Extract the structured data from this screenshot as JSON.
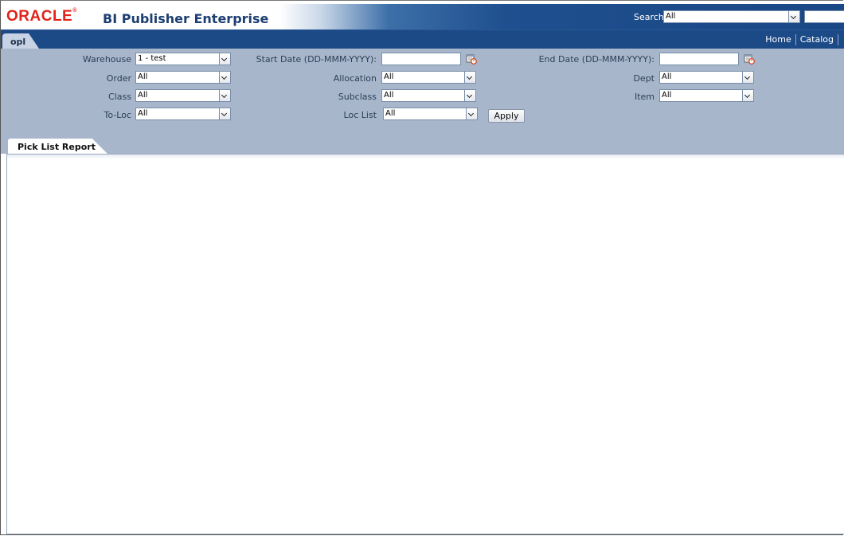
{
  "header": {
    "logo_text": "ORACLE",
    "app_title": "BI Publisher Enterprise",
    "search_label": "Search",
    "search_scope": "All",
    "search_input": ""
  },
  "nav": {
    "tab_label": "opl",
    "links": [
      "Home",
      "Catalog"
    ]
  },
  "params": {
    "warehouse": {
      "label": "Warehouse",
      "value": "1 - test"
    },
    "order": {
      "label": "Order",
      "value": "All"
    },
    "class": {
      "label": "Class",
      "value": "All"
    },
    "to_loc": {
      "label": "To-Loc",
      "value": "All"
    },
    "start_date": {
      "label": "Start Date (DD-MMM-YYYY):",
      "value": ""
    },
    "allocation": {
      "label": "Allocation",
      "value": "All"
    },
    "subclass": {
      "label": "Subclass",
      "value": "All"
    },
    "loc_list": {
      "label": "Loc List",
      "value": "All"
    },
    "end_date": {
      "label": "End Date (DD-MMM-YYYY):",
      "value": ""
    },
    "dept": {
      "label": "Dept",
      "value": "All"
    },
    "item": {
      "label": "Item",
      "value": "All"
    },
    "apply_label": "Apply"
  },
  "report": {
    "tab_label": "Pick List Report"
  },
  "colors": {
    "header_blue": "#1c4a86",
    "param_bg": "#a8b6cb",
    "oracle_red": "#e2231a"
  }
}
